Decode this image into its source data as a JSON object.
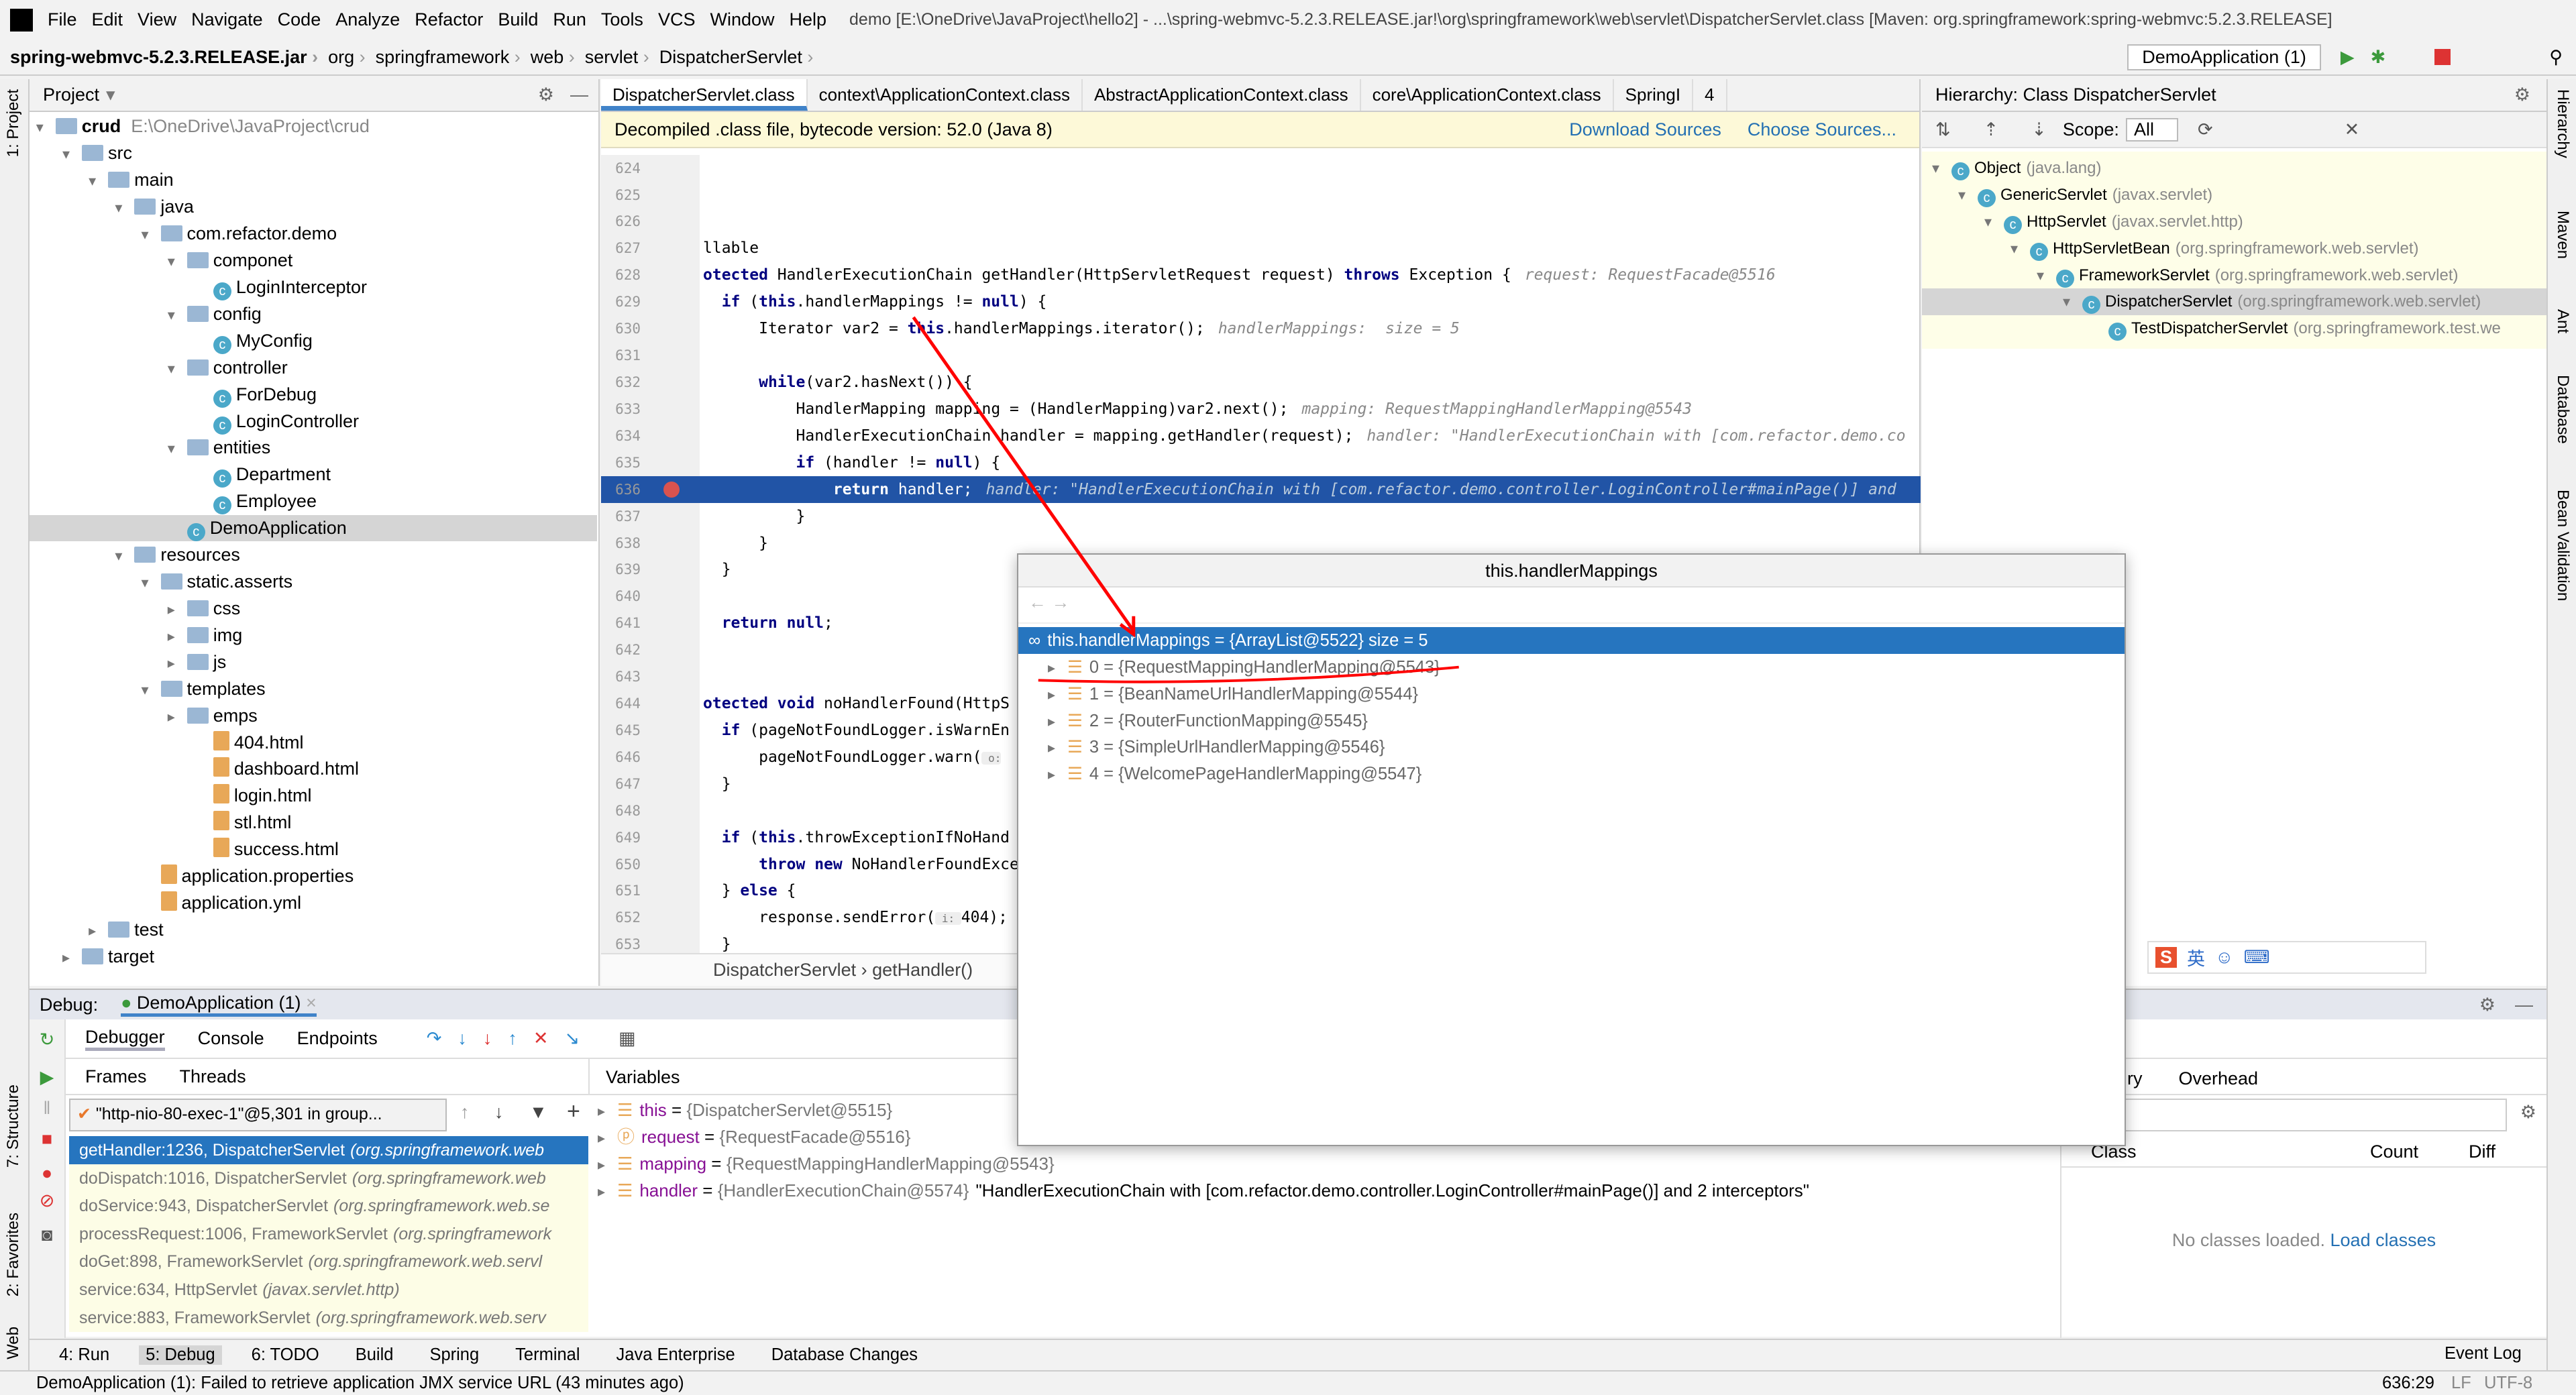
{
  "menu": {
    "items": [
      "File",
      "Edit",
      "View",
      "Navigate",
      "Code",
      "Analyze",
      "Refactor",
      "Build",
      "Run",
      "Tools",
      "VCS",
      "Window",
      "Help"
    ],
    "title": "demo [E:\\OneDrive\\JavaProject\\hello2] - ...\\spring-webmvc-5.2.3.RELEASE.jar!\\org\\springframework\\web\\servlet\\DispatcherServlet.class [Maven: org.springframework:spring-webmvc:5.2.3.RELEASE]"
  },
  "breadcrumbs": [
    "spring-webmvc-5.2.3.RELEASE.jar",
    "org",
    "springframework",
    "web",
    "servlet",
    "DispatcherServlet"
  ],
  "run_config": "DemoApplication (1)",
  "left_strip": [
    "1: Project",
    "7: Structure",
    "2: Favorites",
    "Web"
  ],
  "right_strip": [
    "Hierarchy",
    "Maven",
    "Ant",
    "Database",
    "Bean Validation"
  ],
  "project": {
    "title": "Project",
    "root_path": "E:\\OneDrive\\JavaProject\\crud",
    "tree": [
      {
        "label": "crud",
        "level": 0,
        "icon": "folder",
        "open": true
      },
      {
        "label": "src",
        "level": 1,
        "icon": "folder",
        "open": true
      },
      {
        "label": "main",
        "level": 2,
        "icon": "folder",
        "open": true
      },
      {
        "label": "java",
        "level": 3,
        "icon": "folder",
        "open": true
      },
      {
        "label": "com.refactor.demo",
        "level": 4,
        "icon": "folder",
        "open": true
      },
      {
        "label": "componet",
        "level": 5,
        "icon": "folder",
        "open": true
      },
      {
        "label": "LoginInterceptor",
        "level": 6,
        "icon": "class"
      },
      {
        "label": "config",
        "level": 5,
        "icon": "folder",
        "open": true
      },
      {
        "label": "MyConfig",
        "level": 6,
        "icon": "class"
      },
      {
        "label": "controller",
        "level": 5,
        "icon": "folder",
        "open": true
      },
      {
        "label": "ForDebug",
        "level": 6,
        "icon": "class"
      },
      {
        "label": "LoginController",
        "level": 6,
        "icon": "class"
      },
      {
        "label": "entities",
        "level": 5,
        "icon": "folder",
        "open": true
      },
      {
        "label": "Department",
        "level": 6,
        "icon": "class"
      },
      {
        "label": "Employee",
        "level": 6,
        "icon": "class"
      },
      {
        "label": "DemoApplication",
        "level": 5,
        "icon": "class",
        "selected": true
      },
      {
        "label": "resources",
        "level": 3,
        "icon": "folder",
        "open": true
      },
      {
        "label": "static.asserts",
        "level": 4,
        "icon": "folder",
        "open": true
      },
      {
        "label": "css",
        "level": 5,
        "icon": "folder",
        "open": false
      },
      {
        "label": "img",
        "level": 5,
        "icon": "folder",
        "open": false
      },
      {
        "label": "js",
        "level": 5,
        "icon": "folder",
        "open": false
      },
      {
        "label": "templates",
        "level": 4,
        "icon": "folder",
        "open": true
      },
      {
        "label": "emps",
        "level": 5,
        "icon": "folder",
        "open": false
      },
      {
        "label": "404.html",
        "level": 6,
        "icon": "html"
      },
      {
        "label": "dashboard.html",
        "level": 6,
        "icon": "html"
      },
      {
        "label": "login.html",
        "level": 6,
        "icon": "html"
      },
      {
        "label": "stl.html",
        "level": 6,
        "icon": "html"
      },
      {
        "label": "success.html",
        "level": 6,
        "icon": "html"
      },
      {
        "label": "application.properties",
        "level": 4,
        "icon": "props"
      },
      {
        "label": "application.yml",
        "level": 4,
        "icon": "props"
      },
      {
        "label": "test",
        "level": 2,
        "icon": "folder",
        "open": false
      },
      {
        "label": "target",
        "level": 1,
        "icon": "folder",
        "open": false
      }
    ]
  },
  "editor": {
    "tabs": [
      "DispatcherServlet.class",
      "context\\ApplicationContext.class",
      "AbstractApplicationContext.class",
      "core\\ApplicationContext.class",
      "SpringI"
    ],
    "tab_overflow": "4",
    "banner": "Decompiled .class file, bytecode version: 52.0 (Java 8)",
    "download_sources": "Download Sources",
    "choose_sources": "Choose Sources...",
    "current_line": 636,
    "lines": [
      {
        "n": "624",
        "code": ""
      },
      {
        "n": "625",
        "code": ""
      },
      {
        "n": "626",
        "code": ""
      },
      {
        "n": "627",
        "code": "llable"
      },
      {
        "n": "628",
        "code": "otected HandlerExecutionChain getHandler(HttpServletRequest request) throws Exception {",
        "hint": "request: RequestFacade@5516"
      },
      {
        "n": "629",
        "code": "    if (this.handlerMappings != null) {"
      },
      {
        "n": "630",
        "code": "        Iterator var2 = this.handlerMappings.iterator();",
        "hint": "handlerMappings:  size = 5"
      },
      {
        "n": "631",
        "code": ""
      },
      {
        "n": "632",
        "code": "        while(var2.hasNext()) {"
      },
      {
        "n": "633",
        "code": "            HandlerMapping mapping = (HandlerMapping)var2.next();",
        "hint": "mapping: RequestMappingHandlerMapping@5543"
      },
      {
        "n": "634",
        "code": "            HandlerExecutionChain handler = mapping.getHandler(request);",
        "hint": "handler: \"HandlerExecutionChain with [com.refactor.demo.co"
      },
      {
        "n": "635",
        "code": "            if (handler != null) {"
      },
      {
        "n": "636",
        "code": "                return handler;",
        "hint": "handler: \"HandlerExecutionChain with [com.refactor.demo.controller.LoginController#mainPage()] and"
      },
      {
        "n": "637",
        "code": "            }"
      },
      {
        "n": "638",
        "code": "        }"
      },
      {
        "n": "639",
        "code": "    }"
      },
      {
        "n": "640",
        "code": ""
      },
      {
        "n": "641",
        "code": "    return null;"
      },
      {
        "n": "642",
        "code": ""
      },
      {
        "n": "643",
        "code": ""
      },
      {
        "n": "644",
        "code": "otected void noHandlerFound(HttpS"
      },
      {
        "n": "645",
        "code": "    if (pageNotFoundLogger.isWarnEn"
      },
      {
        "n": "646",
        "code": "        pageNotFoundLogger.warn( o:"
      },
      {
        "n": "647",
        "code": "    }"
      },
      {
        "n": "648",
        "code": ""
      },
      {
        "n": "649",
        "code": "    if (this.throwExceptionIfNoHand"
      },
      {
        "n": "650",
        "code": "        throw new NoHandlerFoundExce"
      },
      {
        "n": "651",
        "code": "    } else {"
      },
      {
        "n": "652",
        "code": "        response.sendError( i: 404);"
      },
      {
        "n": "653",
        "code": "    }"
      }
    ],
    "breadcrumb": [
      "DispatcherServlet",
      "getHandler()"
    ]
  },
  "hierarchy": {
    "title": "Hierarchy:",
    "subtitle": "Class DispatcherServlet",
    "scope_label": "Scope:",
    "scope_value": "All",
    "rows": [
      {
        "name": "Object",
        "pkg": "(java.lang)",
        "level": 0
      },
      {
        "name": "GenericServlet",
        "pkg": "(javax.servlet)",
        "level": 1
      },
      {
        "name": "HttpServlet",
        "pkg": "(javax.servlet.http)",
        "level": 2
      },
      {
        "name": "HttpServletBean",
        "pkg": "(org.springframework.web.servlet)",
        "level": 3
      },
      {
        "name": "FrameworkServlet",
        "pkg": "(org.springframework.web.servlet)",
        "level": 4
      },
      {
        "name": "DispatcherServlet",
        "pkg": "(org.springframework.web.servlet)",
        "level": 5,
        "selected": true
      },
      {
        "name": "TestDispatcherServlet",
        "pkg": "(org.springframework.test.we",
        "level": 6
      }
    ]
  },
  "popup": {
    "title": "this.handlerMappings",
    "root": "this.handlerMappings = {ArrayList@5522}  size = 5",
    "items": [
      "0 = {RequestMappingHandlerMapping@5543}",
      "1 = {BeanNameUrlHandlerMapping@5544}",
      "2 = {RouterFunctionMapping@5545}",
      "3 = {SimpleUrlHandlerMapping@5546}",
      "4 = {WelcomePageHandlerMapping@5547}"
    ]
  },
  "debug": {
    "label": "Debug:",
    "session": "DemoApplication (1)",
    "tabs": [
      "Debugger",
      "Console",
      "Endpoints"
    ],
    "subtabs": [
      "Frames",
      "Threads"
    ],
    "variables_title": "Variables",
    "thread": "\"http-nio-80-exec-1\"@5,301 in group...",
    "frames": [
      {
        "m": "getHandler:1236, DispatcherServlet",
        "p": "(org.springframework.web"
      },
      {
        "m": "doDispatch:1016, DispatcherServlet",
        "p": "(org.springframework.web"
      },
      {
        "m": "doService:943, DispatcherServlet",
        "p": "(org.springframework.web.se"
      },
      {
        "m": "processRequest:1006, FrameworkServlet",
        "p": "(org.springframework"
      },
      {
        "m": "doGet:898, FrameworkServlet",
        "p": "(org.springframework.web.servl"
      },
      {
        "m": "service:634, HttpServlet",
        "p": "(javax.servlet.http)"
      },
      {
        "m": "service:883, FrameworkServlet",
        "p": "(org.springframework.web.serv"
      }
    ],
    "variables": [
      {
        "name": "this",
        "value": "{DispatcherServlet@5515}"
      },
      {
        "name": "request",
        "value": "{RequestFacade@5516}"
      },
      {
        "name": "mapping",
        "value": "{RequestMappingHandlerMapping@5543}"
      },
      {
        "name": "handler",
        "value": "{HandlerExecutionChain@5574}",
        "extra": "\"HandlerExecutionChain with [com.refactor.demo.controller.LoginController#mainPage()] and 2 interceptors\""
      }
    ],
    "memory": {
      "tabs": [
        "ry",
        "Overhead"
      ],
      "cols": [
        "Class",
        "Count",
        "Diff"
      ],
      "empty": "No classes loaded.",
      "load": "Load classes"
    }
  },
  "bottom_tabs": [
    "4: Run",
    "5: Debug",
    "6: TODO",
    "Build",
    "Spring",
    "Terminal",
    "Java Enterprise",
    "Database Changes"
  ],
  "event_log": "Event Log",
  "status": {
    "message": "DemoApplication (1): Failed to retrieve application JMX service URL (43 minutes ago)",
    "position": "636:29",
    "line_sep": "LF",
    "encoding": "UTF-8"
  },
  "ime": "英"
}
